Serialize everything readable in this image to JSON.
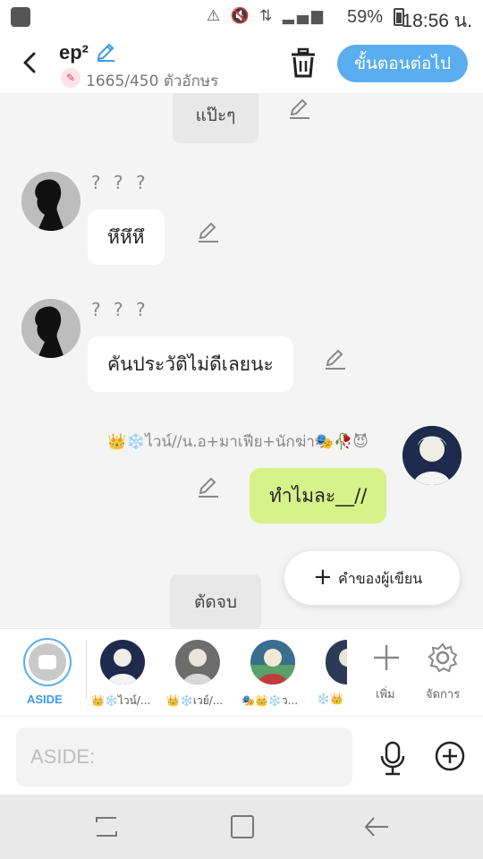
{
  "status_bar": {
    "battery": "59%",
    "time": "18:56 น.",
    "icons": "⚠ 🔇 ⇅ ▂▄▆"
  },
  "header": {
    "title": "ep²",
    "char_count": "1665/450 ตัวอักษร",
    "next_label": "ขั้นตอนต่อไป"
  },
  "messages": [
    {
      "type": "system",
      "text": "แป๊ะๆ"
    },
    {
      "type": "left",
      "speaker": "? ? ?",
      "text": "หึหึหึ"
    },
    {
      "type": "left",
      "speaker": "? ? ?",
      "text": "คันประวัติไม่ดีเลยนะ"
    },
    {
      "type": "right",
      "speaker": "👑❄️ไวน์//น.อ+มาเฟีย+นักฆ่า🎭🥀😈",
      "text": "ทำไมละ__//"
    },
    {
      "type": "system",
      "text": "ตัดจบ"
    }
  ],
  "author_pill": {
    "label": "คำของผู้เขียน"
  },
  "character_bar": {
    "aside_label": "ASIDE",
    "characters": [
      {
        "label": "👑❄️ไวน์/..."
      },
      {
        "label": "👑❄️เวย์/..."
      },
      {
        "label": "🎭👑❄️ว..."
      },
      {
        "label": "❄️👑"
      }
    ],
    "add_label": "เพิ่ม",
    "manage_label": "จัดการ"
  },
  "input": {
    "placeholder": "ASIDE:"
  },
  "colors": {
    "accent": "#5aadee",
    "my_bubble": "#d6f28a",
    "background": "#f4f4f4"
  }
}
